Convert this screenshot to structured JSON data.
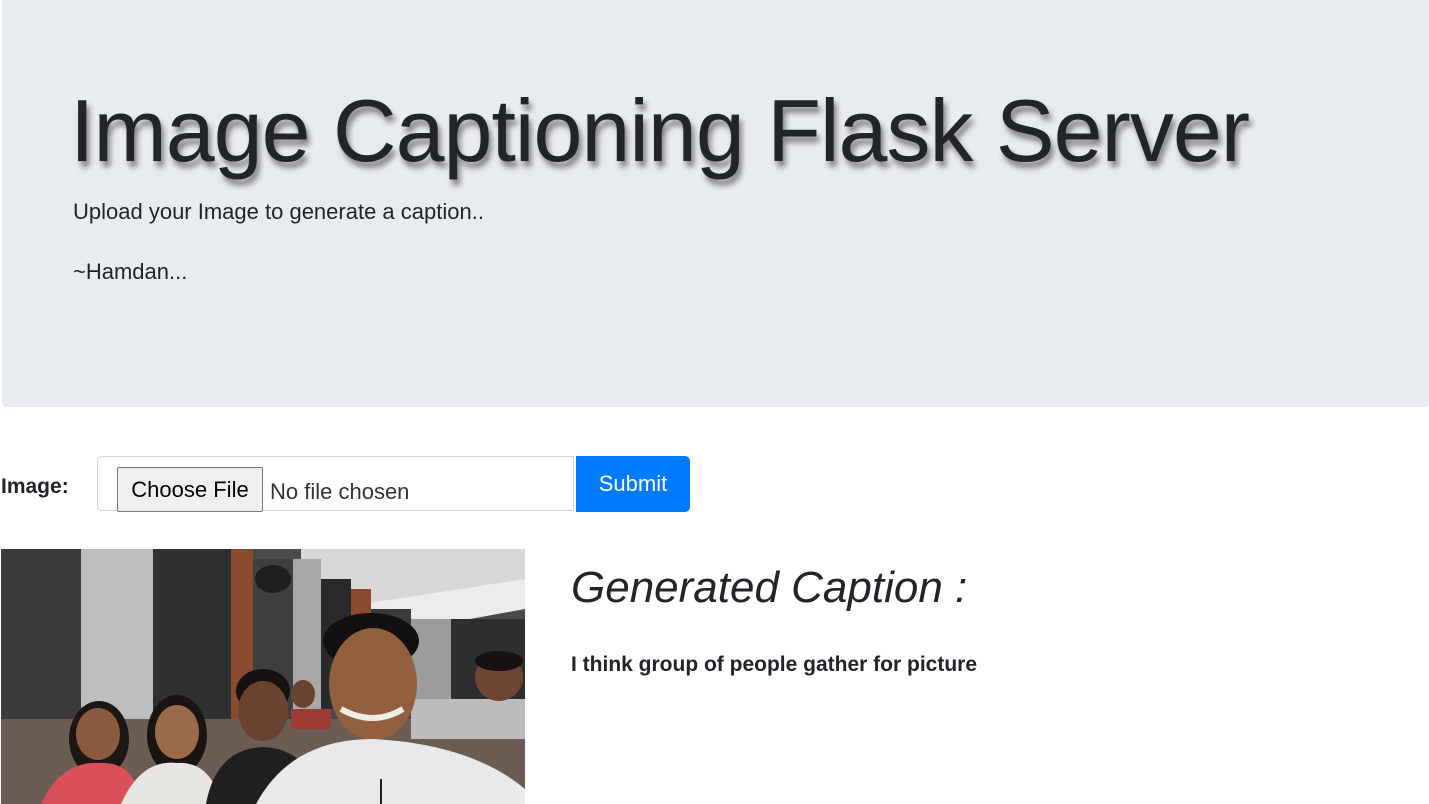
{
  "header": {
    "title": "Image Captioning Flask Server",
    "lead": "Upload your Image to generate a caption..",
    "signature": "~Hamdan..."
  },
  "upload_form": {
    "label": "Image:",
    "choose_file_label": "Choose File",
    "file_status": "No file chosen",
    "submit_label": "Submit"
  },
  "result": {
    "heading": "Generated Caption :",
    "caption": "I think group of people gather for picture"
  },
  "colors": {
    "jumbotron_bg": "#e9ecef",
    "primary_button": "#007bff",
    "text": "#212529"
  }
}
